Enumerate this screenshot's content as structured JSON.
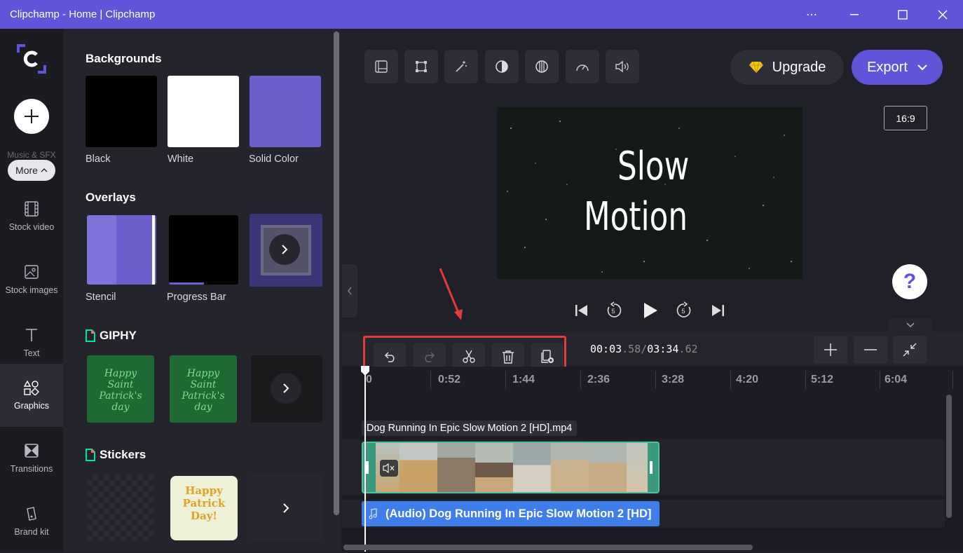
{
  "window": {
    "title": "Clipchamp - Home | Clipchamp"
  },
  "leftnav": {
    "faint_label": "Music & SFX",
    "more_label": "More",
    "items": [
      {
        "label": "Stock video",
        "icon": "film-icon"
      },
      {
        "label": "Stock images",
        "icon": "image-icon"
      },
      {
        "label": "Text",
        "icon": "text-icon"
      },
      {
        "label": "Graphics",
        "icon": "shapes-icon",
        "active": true
      },
      {
        "label": "Transitions",
        "icon": "transition-icon"
      },
      {
        "label": "Brand kit",
        "icon": "brand-icon"
      }
    ]
  },
  "panel": {
    "backgrounds_title": "Backgrounds",
    "backgrounds": [
      {
        "label": "Black"
      },
      {
        "label": "White"
      },
      {
        "label": "Solid Color"
      }
    ],
    "overlays_title": "Overlays",
    "overlays": [
      {
        "label": "Stencil"
      },
      {
        "label": "Progress Bar"
      }
    ],
    "giphy_title": "GIPHY",
    "stickers_title": "Stickers",
    "giphy_text": "Happy Saint Patrick's day",
    "sticker_text": "Happy Patrick Day!"
  },
  "toolbar": {
    "upgrade_label": "Upgrade",
    "export_label": "Export",
    "aspect_ratio": "16:9"
  },
  "preview": {
    "title_line1": "Slow",
    "title_line2": "Motion"
  },
  "help": {
    "label": "?"
  },
  "timeline": {
    "time_current_main": "00:03",
    "time_current_frac": ".58",
    "time_sep": "/",
    "time_total_main": "03:34",
    "time_total_frac": ".62",
    "ruler": [
      "0",
      "0:52",
      "1:44",
      "2:36",
      "3:28",
      "4:20",
      "5:12",
      "6:04"
    ],
    "video_clip_label": "Dog Running In Epic Slow Motion 2 [HD].mp4",
    "audio_clip_label": "(Audio) Dog Running In Epic Slow Motion 2 [HD]"
  },
  "colors": {
    "brand": "#6055d8",
    "highlight": "#e23b3b",
    "audio": "#3f7ee8",
    "video_border": "#4fc29c"
  }
}
